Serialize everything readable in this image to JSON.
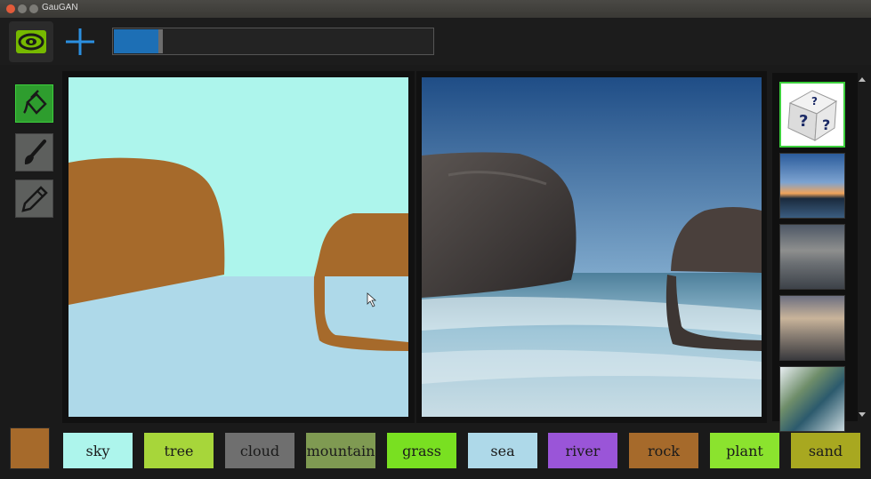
{
  "window": {
    "title": "GauGAN",
    "buttons": [
      "close",
      "minimize",
      "maximize"
    ],
    "button_colors": [
      "#e25b3a",
      "#7c7b76",
      "#7c7b76"
    ]
  },
  "toolbar": {
    "logo_icon": "nvidia-logo-icon",
    "add_icon": "plus-icon",
    "progress_fraction": 0.14
  },
  "tools": [
    {
      "name": "fill-bucket-tool",
      "icon": "paint-bucket-icon",
      "active": true
    },
    {
      "name": "brush-tool",
      "icon": "brush-icon",
      "active": false
    },
    {
      "name": "pencil-tool",
      "icon": "pencil-icon",
      "active": false
    }
  ],
  "colors": {
    "accent_green": "#3ccf3c",
    "progress_blue": "#1d6fb5",
    "sky": "#adf5ec",
    "sea": "#aed9e9",
    "rock": "#a66a2b"
  },
  "current_color": "#a66a2b",
  "thumbnails": [
    "random-style-dice",
    "sunset-coast",
    "cloudy-sea",
    "sunset-rocky-shore",
    "mountain-river"
  ],
  "palette": [
    {
      "label": "sky",
      "color": "#adf5ec"
    },
    {
      "label": "tree",
      "color": "#a7d63a"
    },
    {
      "label": "cloud",
      "color": "#6f6f6f"
    },
    {
      "label": "mountain",
      "color": "#7f9a52"
    },
    {
      "label": "grass",
      "color": "#79e021"
    },
    {
      "label": "sea",
      "color": "#aed9e9"
    },
    {
      "label": "river",
      "color": "#9a55d8"
    },
    {
      "label": "rock",
      "color": "#a66a2b"
    },
    {
      "label": "plant",
      "color": "#8be32e"
    },
    {
      "label": "sand",
      "color": "#a8a820"
    }
  ]
}
